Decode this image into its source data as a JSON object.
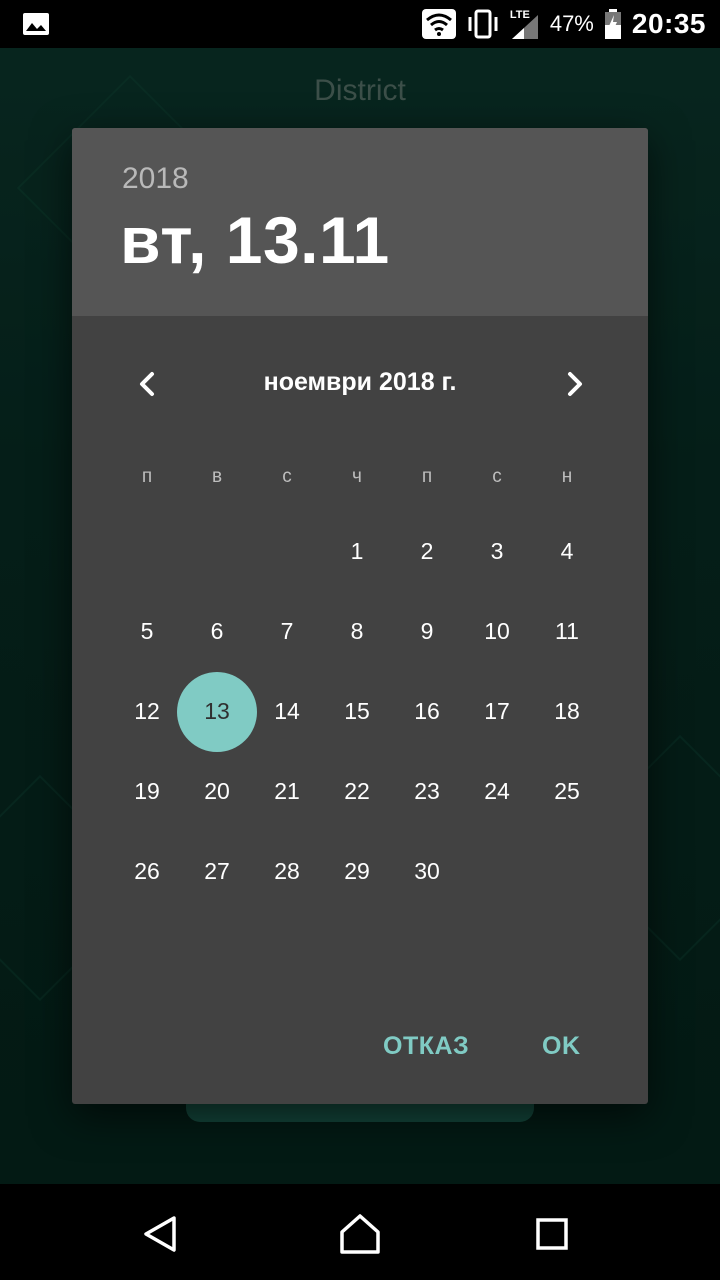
{
  "status_bar": {
    "battery_percent": "47%",
    "time": "20:35",
    "network_label": "LTE",
    "icons": [
      "image-icon",
      "wifi-icon",
      "vibrate-icon",
      "signal-icon",
      "battery-icon"
    ]
  },
  "app": {
    "title": "District"
  },
  "dialog": {
    "year": "2018",
    "selected_date": "вт, 13.11",
    "month_title": "ноември 2018 г.",
    "weekdays": [
      "п",
      "в",
      "с",
      "ч",
      "п",
      "с",
      "н"
    ],
    "days": [
      "1",
      "2",
      "3",
      "4",
      "5",
      "6",
      "7",
      "8",
      "9",
      "10",
      "11",
      "12",
      "13",
      "14",
      "15",
      "16",
      "17",
      "18",
      "19",
      "20",
      "21",
      "22",
      "23",
      "24",
      "25",
      "26",
      "27",
      "28",
      "29",
      "30"
    ],
    "first_weekday_index": 3,
    "selected_day": "13",
    "cancel_label": "ОТКАЗ",
    "ok_label": "OK",
    "accent_color": "#80cbc4"
  }
}
